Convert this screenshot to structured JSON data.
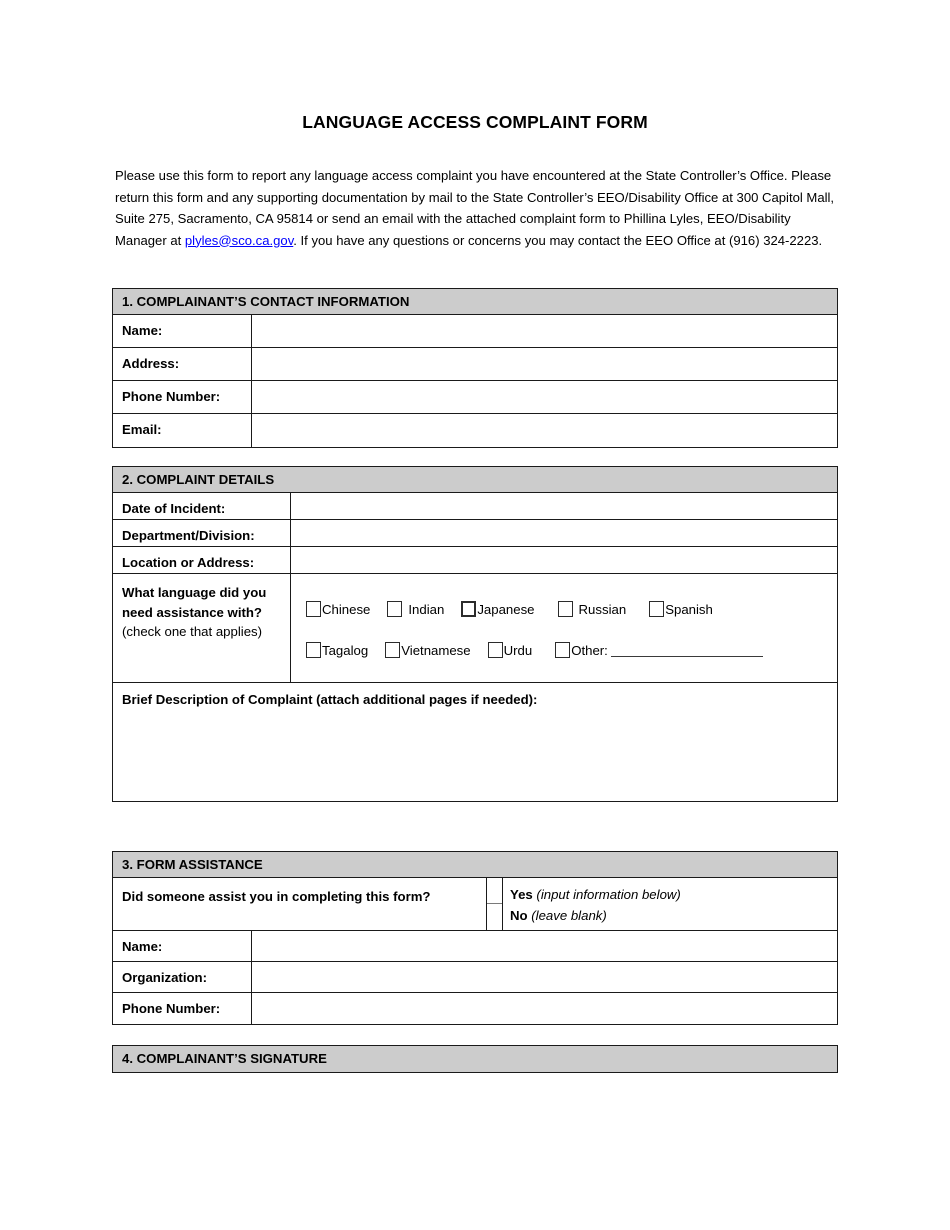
{
  "document": {
    "title": "LANGUAGE ACCESS COMPLAINT FORM",
    "intro": {
      "before_link": "Please use this form to report any language access complaint you have encountered at the State Controller’s Office.  Please return this form and any supporting documentation by mail to the State Controller’s EEO/Disability Office at 300 Capitol Mall, Suite 275, Sacramento, CA 95814 or send an email with the attached complaint form to Phillina Lyles, EEO/Disability Manager at ",
      "link_text": "plyles@sco.ca.gov",
      "after_link": ". If you have any questions or concerns you may contact the EEO Office at (916) 324-2223."
    }
  },
  "section1": {
    "header": "1.  COMPLAINANT’S CONTACT INFORMATION",
    "rows": [
      {
        "label": "Name:",
        "value": ""
      },
      {
        "label": "Address:",
        "value": ""
      },
      {
        "label": "Phone Number:",
        "value": ""
      },
      {
        "label": "Email:",
        "value": ""
      }
    ]
  },
  "section2": {
    "header": "2. COMPLAINT DETAILS",
    "rows": [
      {
        "label": "Date of Incident:",
        "value": ""
      },
      {
        "label": "Department/Division:",
        "value": ""
      },
      {
        "label": "Location or Address:",
        "value": ""
      }
    ],
    "language_question": {
      "question": "What language did you need assistance with?",
      "hint": "(check one that applies)",
      "row1": [
        {
          "label": "Chinese",
          "checked": false
        },
        {
          "label": "Indian",
          "checked": false
        },
        {
          "label": "Japanese",
          "checked": false
        },
        {
          "label": "Russian",
          "checked": false
        },
        {
          "label": "Spanish",
          "checked": false
        }
      ],
      "row2": [
        {
          "label": "Tagalog",
          "checked": false
        },
        {
          "label": "Vietnamese",
          "checked": false
        },
        {
          "label": "Urdu",
          "checked": false
        },
        {
          "label": "Other:",
          "checked": false
        }
      ],
      "other_value": ""
    },
    "description": {
      "label": "Brief Description of Complaint (attach additional pages if needed):",
      "value": ""
    }
  },
  "section3": {
    "header": "3. FORM ASSISTANCE",
    "question": "Did someone assist you in completing this form?",
    "options": [
      {
        "bold": "Yes",
        "note": "(input information below)",
        "checked": false
      },
      {
        "bold": "No",
        "note": "(leave blank)",
        "checked": false
      }
    ],
    "rows": [
      {
        "label": "Name:",
        "value": ""
      },
      {
        "label": "Organization:",
        "value": ""
      },
      {
        "label": "Phone Number:",
        "value": ""
      }
    ]
  },
  "section4": {
    "header": "4. COMPLAINANT’S SIGNATURE"
  },
  "colors": {
    "header_fill": "#CCCCCC",
    "border": "#1A1A1A",
    "link": "#0000FF",
    "text": "#000000"
  }
}
